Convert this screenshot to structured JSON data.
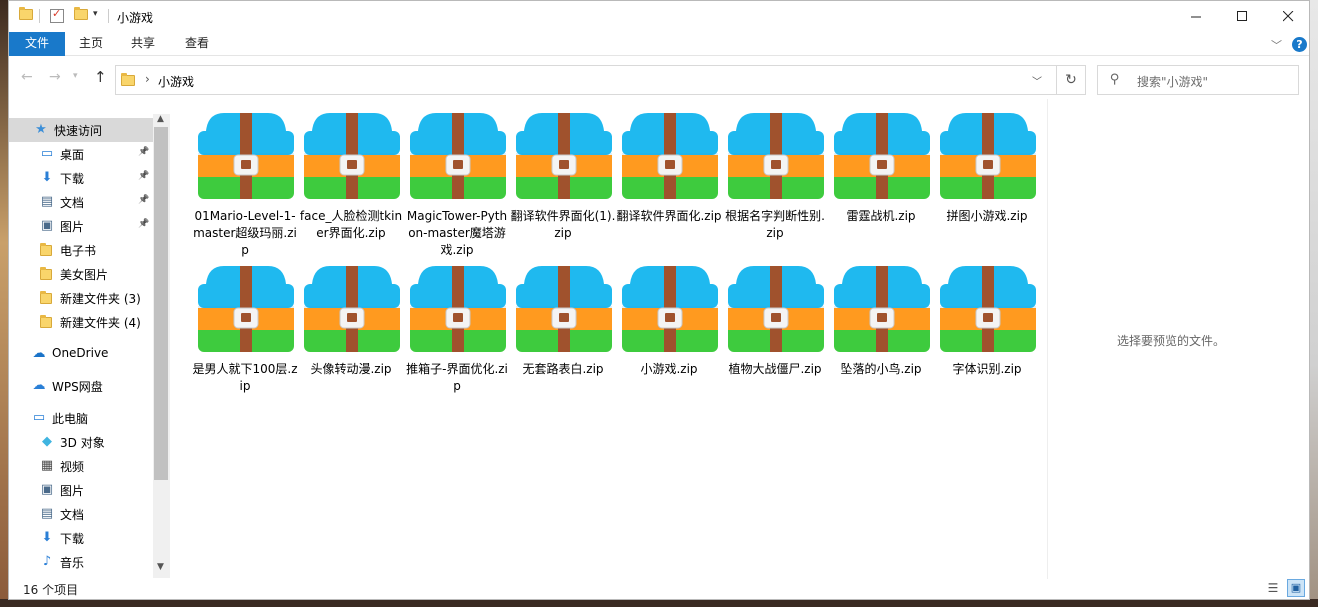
{
  "window": {
    "title": "小游戏",
    "qa_dropdown": "▾"
  },
  "ribbon": {
    "tabs": [
      "文件",
      "主页",
      "共享",
      "查看"
    ]
  },
  "address": {
    "path": "小游戏",
    "search_placeholder": "搜索\"小游戏\""
  },
  "nav": {
    "items": [
      {
        "label": "快速访问",
        "icon": "star-icon",
        "pinned": false
      },
      {
        "label": "桌面",
        "icon": "desktop-icon",
        "pinned": true
      },
      {
        "label": "下载",
        "icon": "download-icon",
        "pinned": true
      },
      {
        "label": "文档",
        "icon": "document-icon",
        "pinned": true
      },
      {
        "label": "图片",
        "icon": "picture-icon",
        "pinned": true
      },
      {
        "label": "电子书",
        "icon": "folder-icon",
        "pinned": false
      },
      {
        "label": "美女图片",
        "icon": "folder-icon",
        "pinned": false
      },
      {
        "label": "新建文件夹 (3)",
        "icon": "folder-icon",
        "pinned": false
      },
      {
        "label": "新建文件夹 (4)",
        "icon": "folder-icon",
        "pinned": false
      },
      {
        "label": "OneDrive",
        "icon": "onedrive-icon",
        "pinned": false
      },
      {
        "label": "WPS网盘",
        "icon": "wps-cloud-icon",
        "pinned": false
      },
      {
        "label": "此电脑",
        "icon": "computer-icon",
        "pinned": false
      },
      {
        "label": "3D 对象",
        "icon": "3d-objects-icon",
        "pinned": false
      },
      {
        "label": "视频",
        "icon": "video-icon",
        "pinned": false
      },
      {
        "label": "图片",
        "icon": "picture-icon",
        "pinned": false
      },
      {
        "label": "文档",
        "icon": "document-icon",
        "pinned": false
      },
      {
        "label": "下载",
        "icon": "download-icon",
        "pinned": false
      },
      {
        "label": "音乐",
        "icon": "music-icon",
        "pinned": false
      }
    ]
  },
  "files": [
    "01Mario-Level-1-master超级玛丽.zip",
    "face_人脸检测tkiner界面化.zip",
    "MagicTower-Python-master魔塔游戏.zip",
    "翻译软件界面化(1).zip",
    "翻译软件界面化.zip",
    "根据名字判断性别.zip",
    "雷霆战机.zip",
    "拼图小游戏.zip",
    "是男人就下100层.zip",
    "头像转动漫.zip",
    "推箱子-界面优化.zip",
    "无套路表白.zip",
    "小游戏.zip",
    "植物大战僵尸.zip",
    "坠落的小鸟.zip",
    "字体识别.zip"
  ],
  "preview": {
    "message": "选择要预览的文件。"
  },
  "status": {
    "item_count": "16 个项目"
  },
  "colors": {
    "accent": "#1979ca",
    "zip_top": "#1fb9ef",
    "zip_middle": "#ff9a1f",
    "zip_bottom": "#3ecb3e",
    "zip_strap": "#a0522d"
  }
}
